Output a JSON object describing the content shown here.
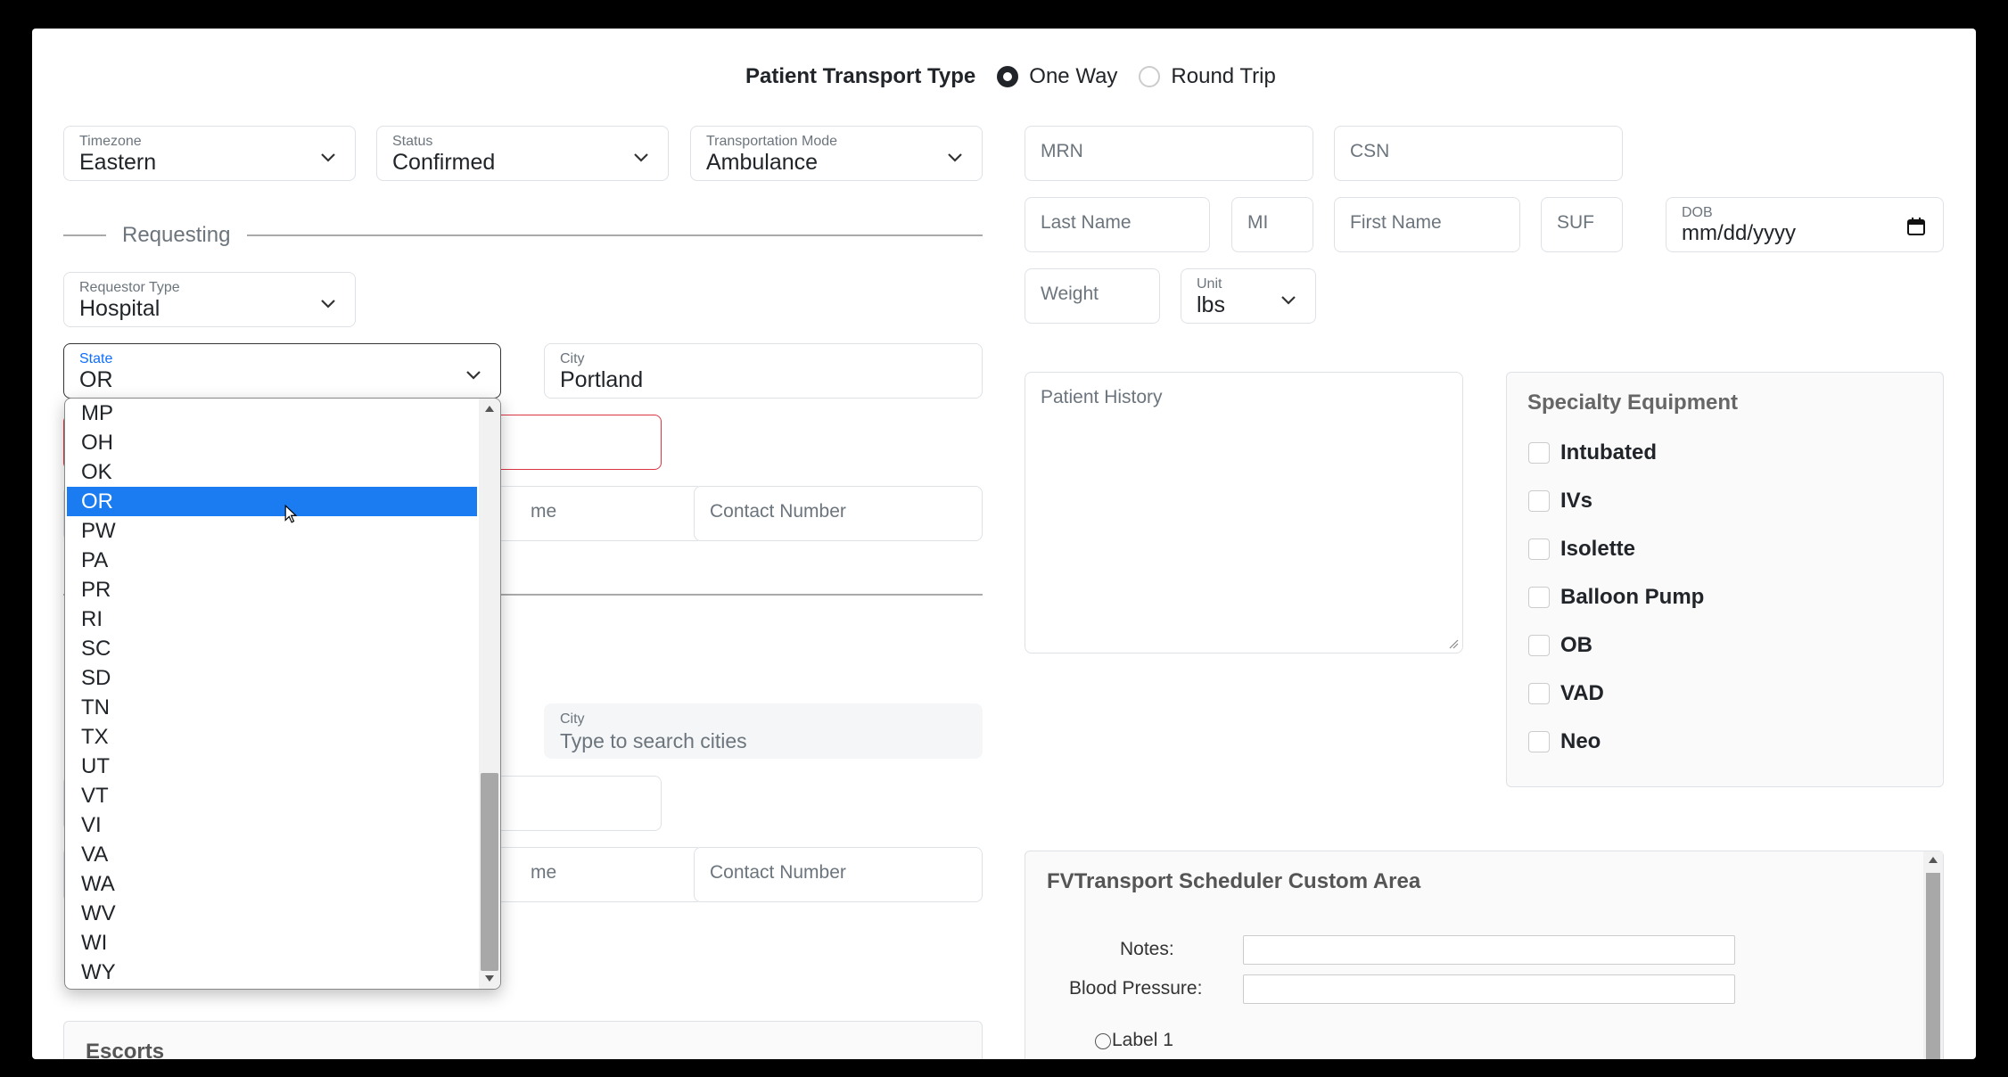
{
  "transport": {
    "label": "Patient Transport Type",
    "one_way": "One Way",
    "round_trip": "Round Trip"
  },
  "timezone": {
    "label": "Timezone",
    "value": "Eastern"
  },
  "status": {
    "label": "Status",
    "value": "Confirmed"
  },
  "mode": {
    "label": "Transportation Mode",
    "value": "Ambulance"
  },
  "patient": {
    "mrn": "MRN",
    "csn": "CSN",
    "last_name": "Last Name",
    "mi": "MI",
    "first_name": "First Name",
    "suf": "SUF",
    "dob_label": "DOB",
    "dob_value": "mm/dd/yyyy",
    "weight": "Weight",
    "unit_label": "Unit",
    "unit_value": "lbs",
    "history": "Patient History"
  },
  "requesting": {
    "legend": "Requesting",
    "requestor_type_label": "Requestor Type",
    "requestor_type_value": "Hospital",
    "state_label": "State",
    "state_value": "OR",
    "city_label": "City",
    "city_value": "Portland",
    "contact_name_partial": "me",
    "contact_number": "Contact Number"
  },
  "receiving": {
    "city_label": "City",
    "city_placeholder": "Type to search cities",
    "contact_name_partial": "me",
    "contact_number": "Contact Number"
  },
  "escorts": {
    "title": "Escorts"
  },
  "equipment": {
    "title": "Specialty Equipment",
    "items": [
      "Intubated",
      "IVs",
      "Isolette",
      "Balloon Pump",
      "OB",
      "VAD",
      "Neo"
    ]
  },
  "custom": {
    "title": "FVTransport Scheduler Custom Area",
    "notes": "Notes:",
    "bp": "Blood Pressure:",
    "label1": "Label 1"
  },
  "state_dropdown": {
    "options": [
      "MP",
      "OH",
      "OK",
      "OR",
      "PW",
      "PA",
      "PR",
      "RI",
      "SC",
      "SD",
      "TN",
      "TX",
      "UT",
      "VT",
      "VI",
      "VA",
      "WA",
      "WV",
      "WI",
      "WY"
    ],
    "selected": "OR"
  }
}
